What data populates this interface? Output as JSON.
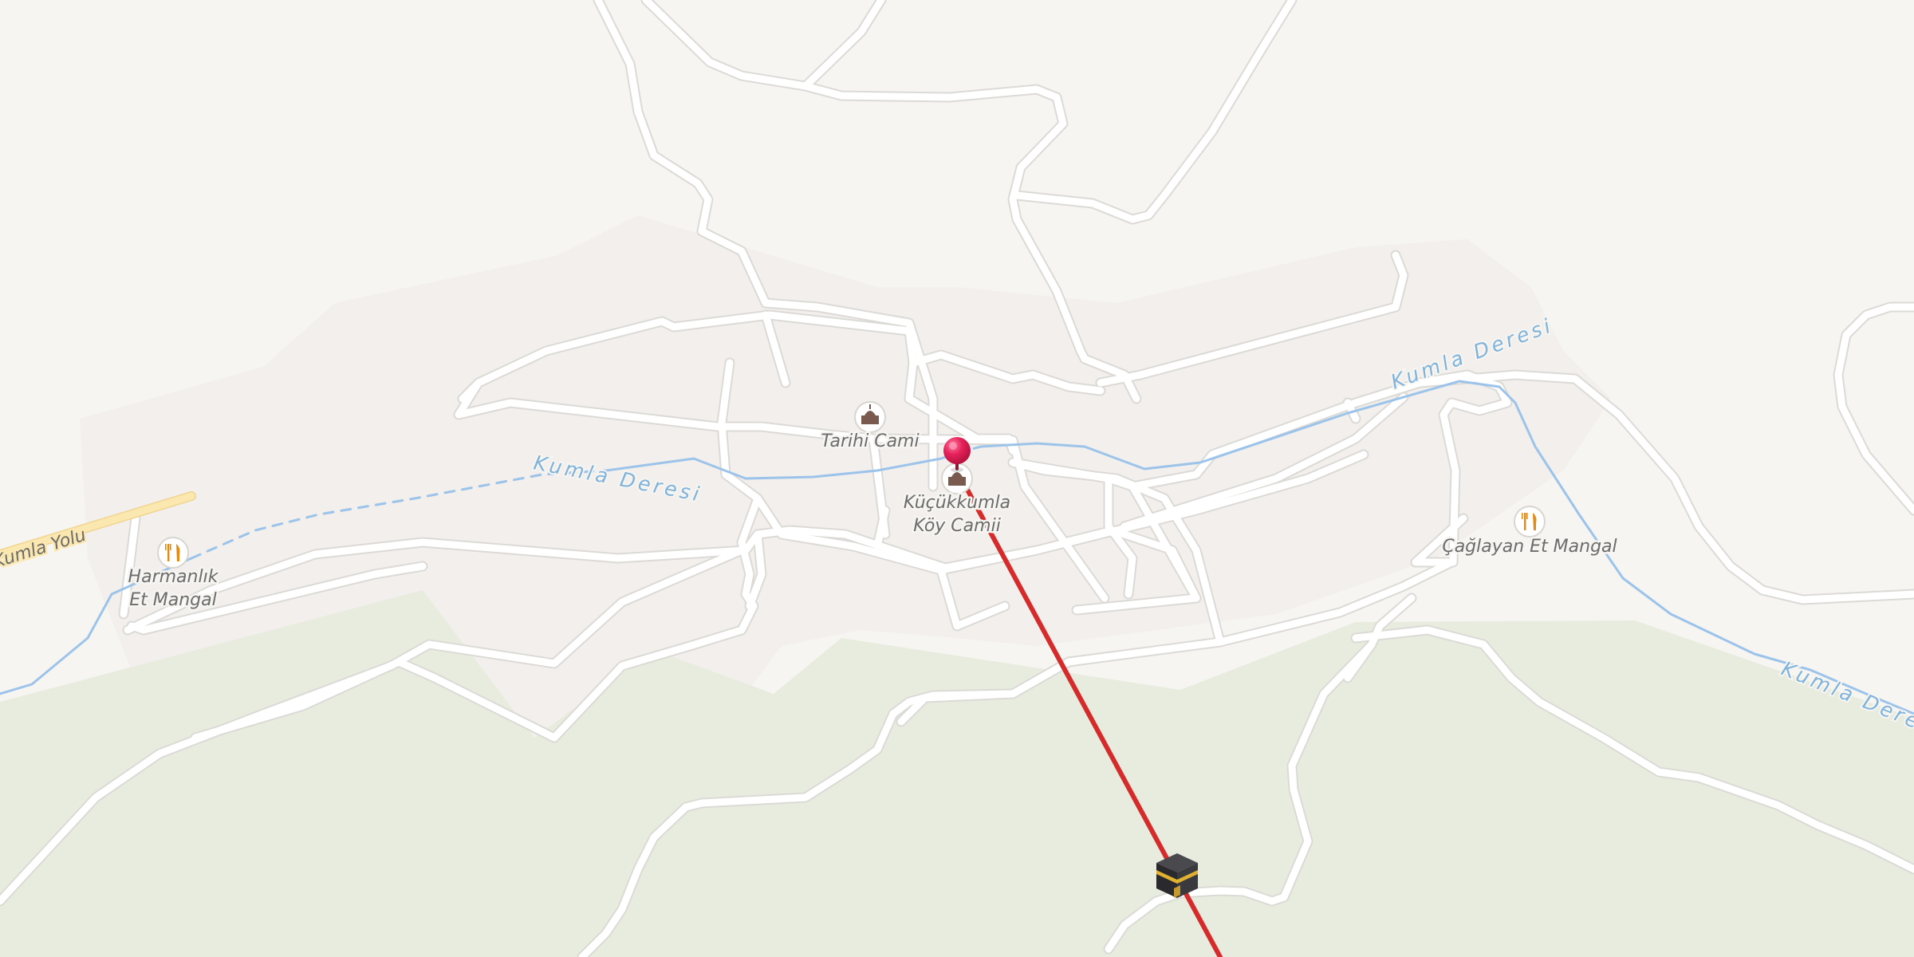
{
  "map": {
    "pois": [
      {
        "id": "tarihi-cami",
        "type": "mosque",
        "icon": "mosque-icon",
        "lines": [
          "Tarihi Cami"
        ]
      },
      {
        "id": "kucukkumla-koy-camii",
        "type": "mosque",
        "icon": "mosque-icon",
        "lines": [
          "Küçükkumla",
          "Köy Camii"
        ]
      },
      {
        "id": "harmanlik-et-mangal",
        "type": "restaurant",
        "icon": "fork-knife-icon",
        "lines": [
          "Harmanlık",
          "Et Mangal"
        ]
      },
      {
        "id": "caglayan-et-mangal",
        "type": "restaurant",
        "icon": "fork-knife-icon",
        "lines": [
          "Çağlayan Et Mangal"
        ]
      }
    ],
    "water_labels": [
      "Kumla Deresi",
      "Kumla Deresi",
      "Kumla Deresi"
    ],
    "road_labels": [
      "Kumla Yolu"
    ],
    "markers": {
      "current_location": {
        "icon": "location-pin-icon",
        "color": "#e5225a"
      },
      "qibla": {
        "icon": "kaaba-icon"
      }
    },
    "colors": {
      "background": "#f7f5f2",
      "residential": "#f2efec",
      "forest": "#e8ecdf",
      "road": "#ffffff",
      "road_casing": "#dcdad6",
      "water": "#9cc4ea",
      "highway": "#fbe7b0",
      "qibla_line": "#d62b2b",
      "poi_mosque": "#7a5a4e",
      "poi_restaurant": "#e38b12"
    }
  }
}
